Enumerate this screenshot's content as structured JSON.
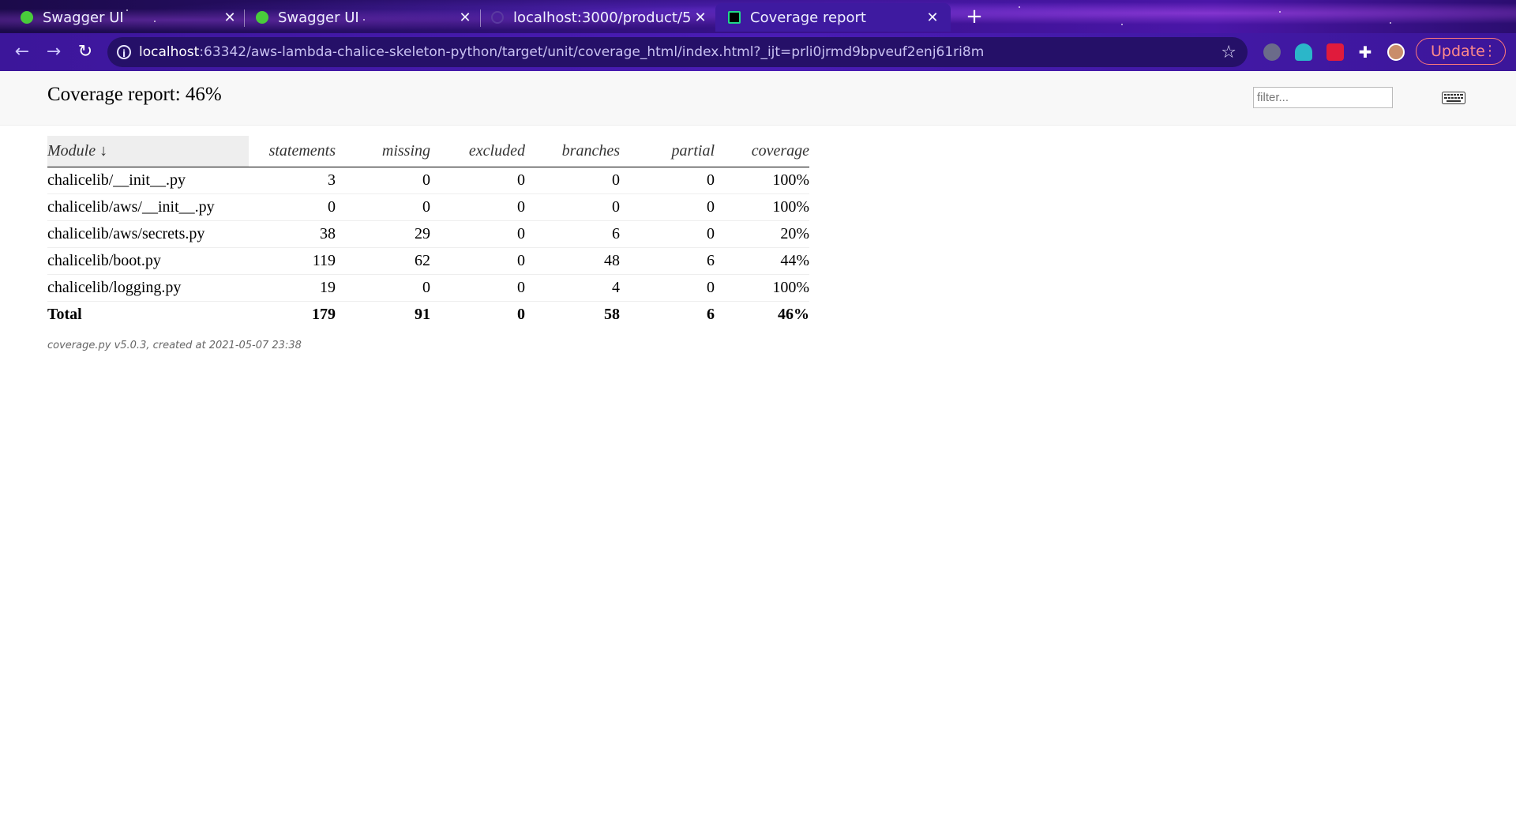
{
  "browser": {
    "tabs": [
      {
        "title": "Swagger UI",
        "favicon": "swagger-icon",
        "active": false
      },
      {
        "title": "Swagger UI",
        "favicon": "swagger-icon",
        "active": false
      },
      {
        "title": "localhost:3000/product/5",
        "favicon": "globe-icon",
        "active": false
      },
      {
        "title": "Coverage report",
        "favicon": "pycharm-icon",
        "active": true
      }
    ],
    "address": {
      "host": "localhost",
      "rest": ":63342/aws-lambda-chalice-skeleton-python/target/unit/coverage_html/index.html?_ijt=prli0jrmd9bpveuf2enj61ri8m"
    },
    "update_label": "Update"
  },
  "report": {
    "title": "Coverage report: 46%",
    "filter_placeholder": "filter...",
    "columns": {
      "module": "Module ↓",
      "statements": "statements",
      "missing": "missing",
      "excluded": "excluded",
      "branches": "branches",
      "partial": "partial",
      "coverage": "coverage"
    },
    "rows": [
      {
        "module": "chalicelib/__init__.py",
        "statements": "3",
        "missing": "0",
        "excluded": "0",
        "branches": "0",
        "partial": "0",
        "coverage": "100%"
      },
      {
        "module": "chalicelib/aws/__init__.py",
        "statements": "0",
        "missing": "0",
        "excluded": "0",
        "branches": "0",
        "partial": "0",
        "coverage": "100%"
      },
      {
        "module": "chalicelib/aws/secrets.py",
        "statements": "38",
        "missing": "29",
        "excluded": "0",
        "branches": "6",
        "partial": "0",
        "coverage": "20%"
      },
      {
        "module": "chalicelib/boot.py",
        "statements": "119",
        "missing": "62",
        "excluded": "0",
        "branches": "48",
        "partial": "6",
        "coverage": "44%"
      },
      {
        "module": "chalicelib/logging.py",
        "statements": "19",
        "missing": "0",
        "excluded": "0",
        "branches": "4",
        "partial": "0",
        "coverage": "100%"
      }
    ],
    "total": {
      "module": "Total",
      "statements": "179",
      "missing": "91",
      "excluded": "0",
      "branches": "58",
      "partial": "6",
      "coverage": "46%"
    },
    "footer": "coverage.py v5.0.3, created at 2021-05-07 23:38"
  }
}
